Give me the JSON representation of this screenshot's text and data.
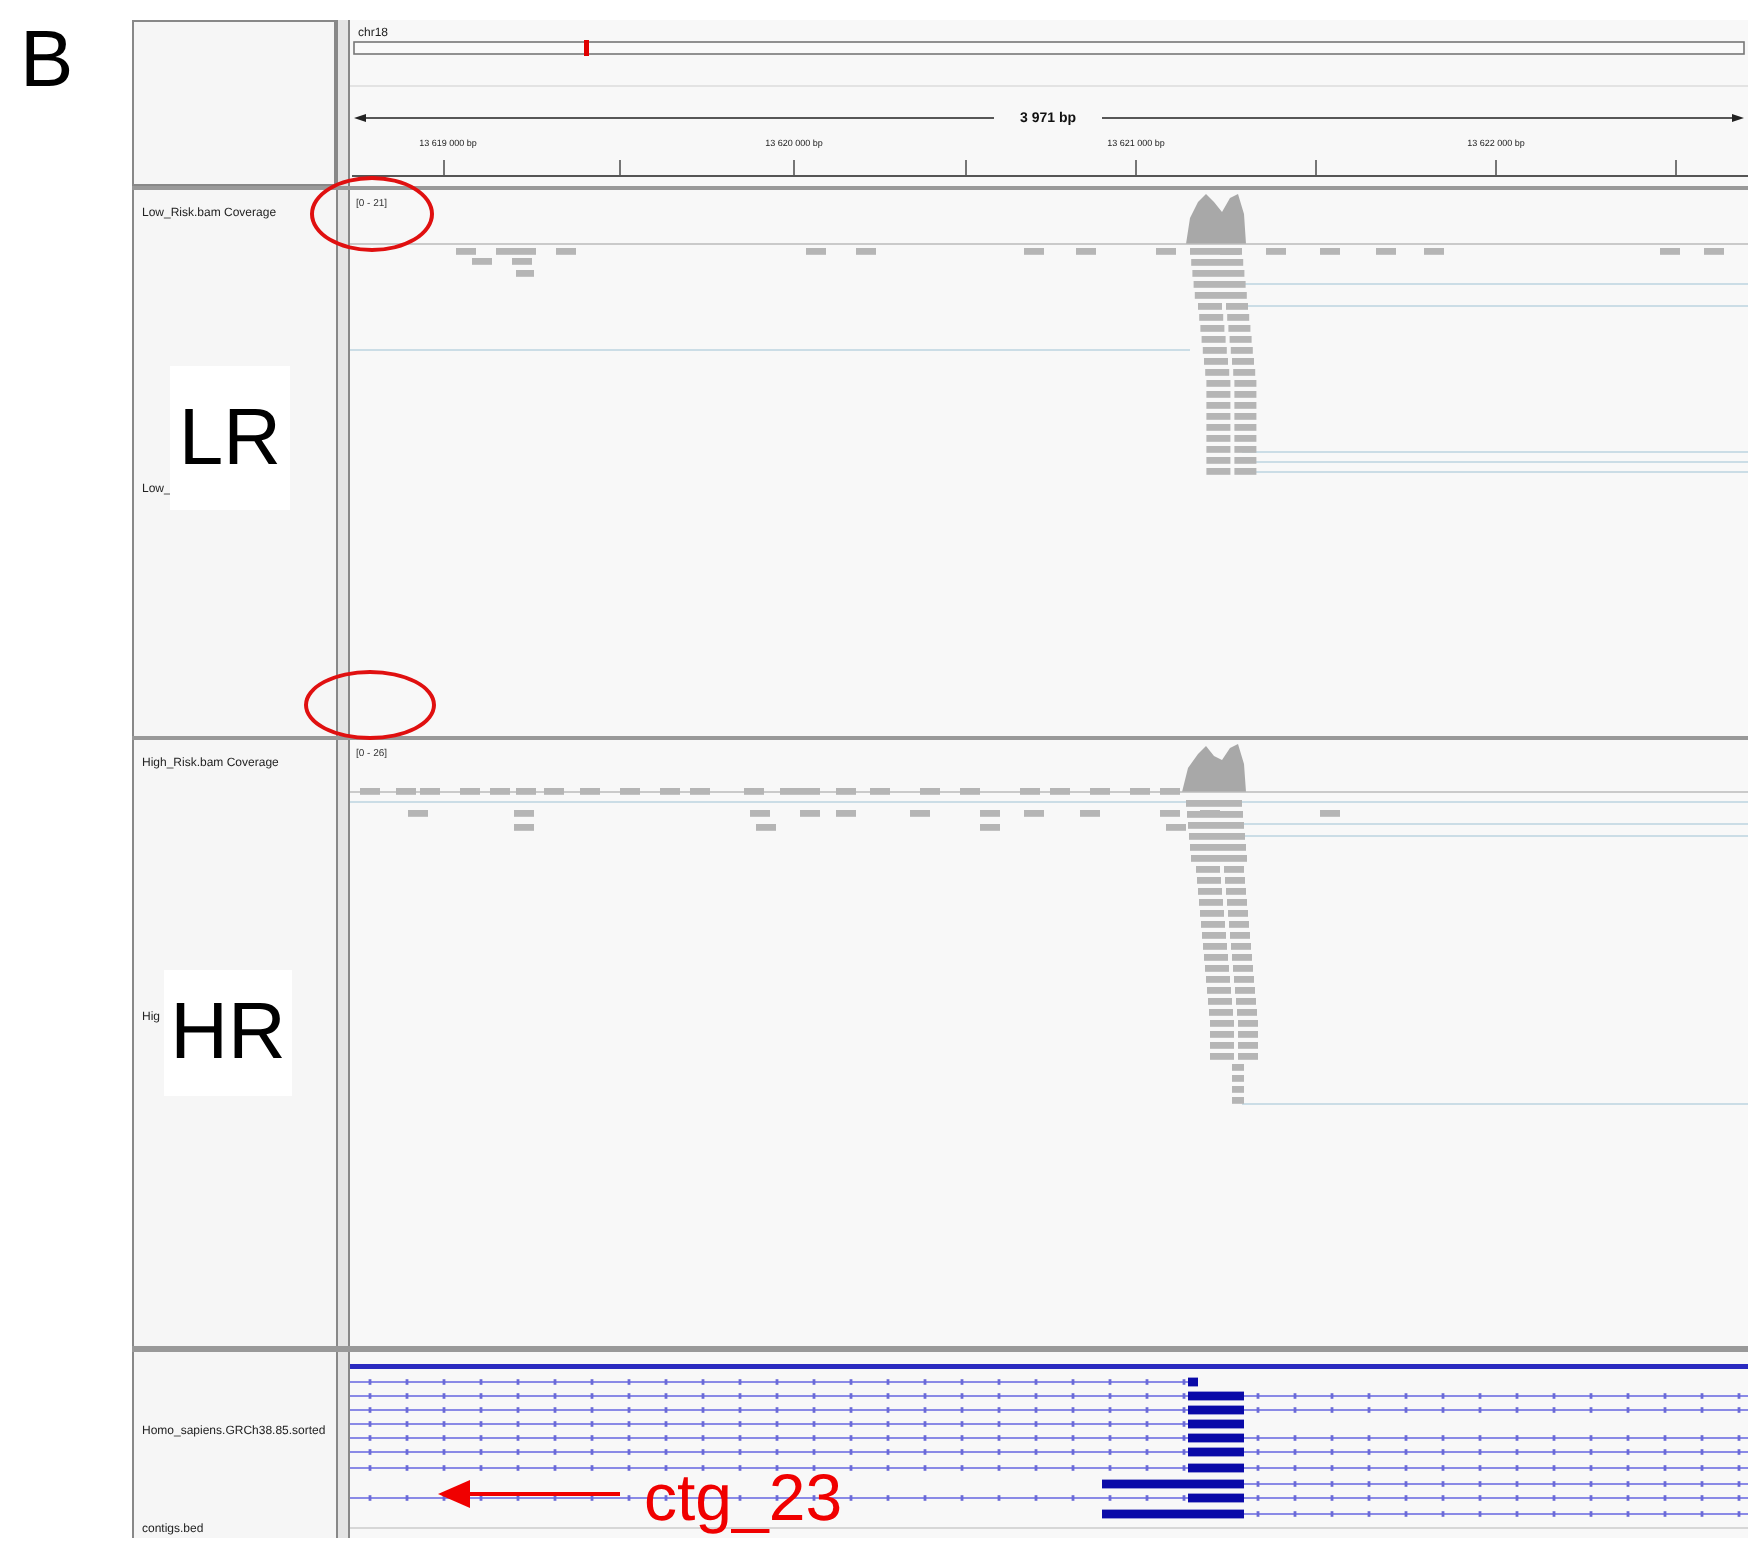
{
  "figure_label": "B",
  "header": {
    "chromosome": "chr18",
    "span": "3 971 bp",
    "ticks": [
      "13 619 000 bp",
      "13 620 000 bp",
      "13 621 000 bp",
      "13 622 000 bp"
    ]
  },
  "tracks": [
    {
      "name": "Low_Risk.bam Coverage",
      "range": "[0 - 21]",
      "sublabel": "Low_",
      "annotation": "LR"
    },
    {
      "name": "High_Risk.bam Coverage",
      "range": "[0 - 26]",
      "sublabel": "Hig",
      "annotation": "HR"
    }
  ],
  "feature_tracks": [
    {
      "name": "Homo_sapiens.GRCh38.85.sorted"
    },
    {
      "name": "contigs.bed"
    }
  ],
  "callout": "ctg_23"
}
